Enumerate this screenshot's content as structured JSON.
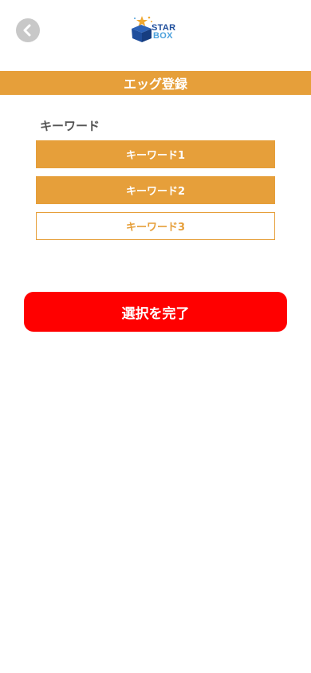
{
  "header": {
    "back_icon": "chevron-left-icon",
    "logo": {
      "line1": "STAR",
      "line2": "BOX"
    }
  },
  "title": "エッグ登録",
  "keywords": {
    "label": "キーワード",
    "items": [
      {
        "label": "キーワード1",
        "selected": true
      },
      {
        "label": "キーワード2",
        "selected": true
      },
      {
        "label": "キーワード3",
        "selected": false
      }
    ]
  },
  "complete_button": "選択を完了",
  "colors": {
    "accent": "#e69f3a",
    "primary_button": "#ff0000",
    "back_button": "#c8c8c8",
    "logo_navy": "#1f4e9c",
    "logo_light": "#4aa0dc"
  }
}
